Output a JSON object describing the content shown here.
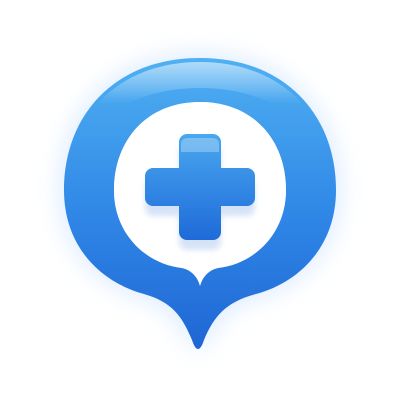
{
  "icon": {
    "name": "medical-location-pin-plus-icon",
    "shape": "location-pin",
    "symbol": "plus",
    "colors": {
      "background": "#ffffff",
      "pin_light": "#4fb0f2",
      "pin_mid": "#2f86e6",
      "pin_dark": "#1f66d4",
      "inner_fill": "#ffffff",
      "plus_light": "#49a8f0",
      "plus_dark": "#1f6ad8",
      "glow": "#7fb8ff"
    }
  }
}
